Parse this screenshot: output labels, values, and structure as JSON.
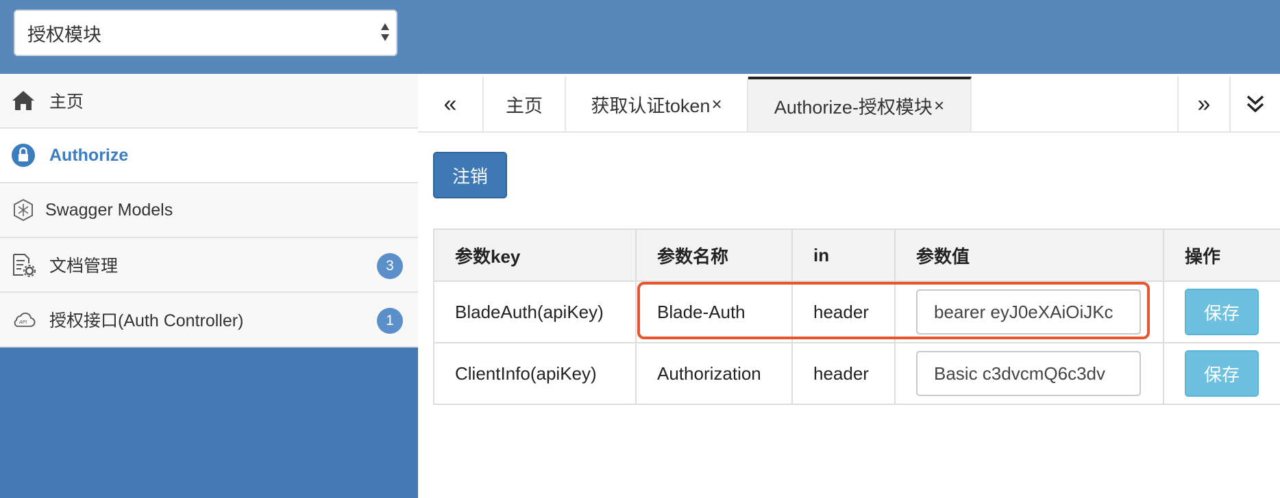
{
  "header": {
    "module_select": {
      "value": "授权模块"
    }
  },
  "sidebar": {
    "items": [
      {
        "label": "主页",
        "icon": "home-icon"
      },
      {
        "label": "Authorize",
        "icon": "lock-icon",
        "active": true
      },
      {
        "label": "Swagger Models",
        "icon": "swagger-models-icon"
      },
      {
        "label": "文档管理",
        "icon": "doc-settings-icon",
        "badge": "3"
      },
      {
        "label": "授权接口(Auth Controller)",
        "icon": "api-cloud-icon",
        "badge": "1"
      }
    ]
  },
  "tabs": {
    "prev": "«",
    "next": "»",
    "more": "⌄",
    "items": [
      {
        "label": "主页"
      },
      {
        "label": "获取认证token",
        "close": "×"
      },
      {
        "label": "Authorize-授权模块",
        "close": "×",
        "active": true
      }
    ]
  },
  "authorize": {
    "logout_label": "注销",
    "columns": [
      "参数key",
      "参数名称",
      "in",
      "参数值",
      "操作"
    ],
    "rows": [
      {
        "key": "BladeAuth(apiKey)",
        "name": "Blade-Auth",
        "in": "header",
        "value": "bearer eyJ0eXAiOiJKc",
        "action": "保存"
      },
      {
        "key": "ClientInfo(apiKey)",
        "name": "Authorization",
        "in": "header",
        "value": "Basic c3dvcmQ6c3dv",
        "action": "保存"
      }
    ]
  },
  "colors": {
    "topbar": "#5887b9",
    "sidebar": "#4279b2",
    "accent": "#3b7dbf",
    "highlight": "#e8552d",
    "save_button": "#6ec0e0"
  }
}
